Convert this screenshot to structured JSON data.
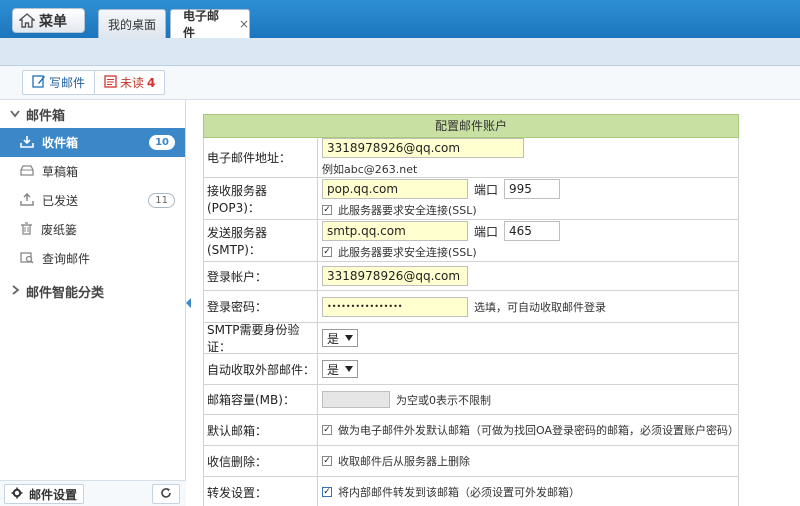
{
  "topbar": {
    "menu_label": "菜单",
    "tabs": [
      {
        "label": "我的桌面"
      },
      {
        "label": "电子邮件",
        "close": "×"
      }
    ]
  },
  "toolbar": {
    "compose_label": "写邮件",
    "unread_label": "未读",
    "unread_count": "4"
  },
  "sidebar": {
    "mailbox_section": "邮件箱",
    "items": [
      {
        "label": "收件箱",
        "badge": "10",
        "icon": "inbox-icon"
      },
      {
        "label": "草稿箱",
        "badge": "",
        "icon": "draft-icon"
      },
      {
        "label": "已发送",
        "badge": "11",
        "icon": "sent-icon"
      },
      {
        "label": "废纸篓",
        "badge": "",
        "icon": "trash-icon"
      },
      {
        "label": "查询邮件",
        "badge": "",
        "icon": "search-mail-icon"
      }
    ],
    "smart_section": "邮件智能分类",
    "settings_label": "邮件设置"
  },
  "form": {
    "title": "配置邮件账户",
    "email_label": "电子邮件地址：",
    "email_value": "3318978926@qq.com",
    "email_example": "例如abc@263.net",
    "pop3_label": "接收服务器(POP3)：",
    "pop3_value": "pop.qq.com",
    "port_label": "端口",
    "pop3_port": "995",
    "ssl_label": "此服务器要求安全连接(SSL)",
    "smtp_label": "发送服务器(SMTP)：",
    "smtp_value": "smtp.qq.com",
    "smtp_port": "465",
    "login_label": "登录帐户：",
    "login_value": "3318978926@qq.com",
    "password_label": "登录密码：",
    "password_value": "••••••••••••••••",
    "password_hint": "选填，可自动收取邮件登录",
    "smtp_auth_label": "SMTP需要身份验证：",
    "smtp_auth_value": "是",
    "auto_fetch_label": "自动收取外部邮件：",
    "auto_fetch_value": "是",
    "capacity_label": "邮箱容量(MB)：",
    "capacity_hint": "为空或0表示不限制",
    "default_label": "默认邮箱：",
    "default_text": "做为电子邮件外发默认邮箱（可做为找回OA登录密码的邮箱，必须设置账户密码）",
    "delete_label": "收信删除：",
    "delete_text": "收取邮件后从服务器上删除",
    "forward_label": "转发设置：",
    "forward_text": "将内部邮件转发到该邮箱（必须设置可外发邮箱）"
  },
  "colors": {
    "topbar": "#1f7cc4",
    "active_nav": "#3b87c8",
    "form_header": "#c8e0a1",
    "input_fill": "#ffffcf"
  }
}
